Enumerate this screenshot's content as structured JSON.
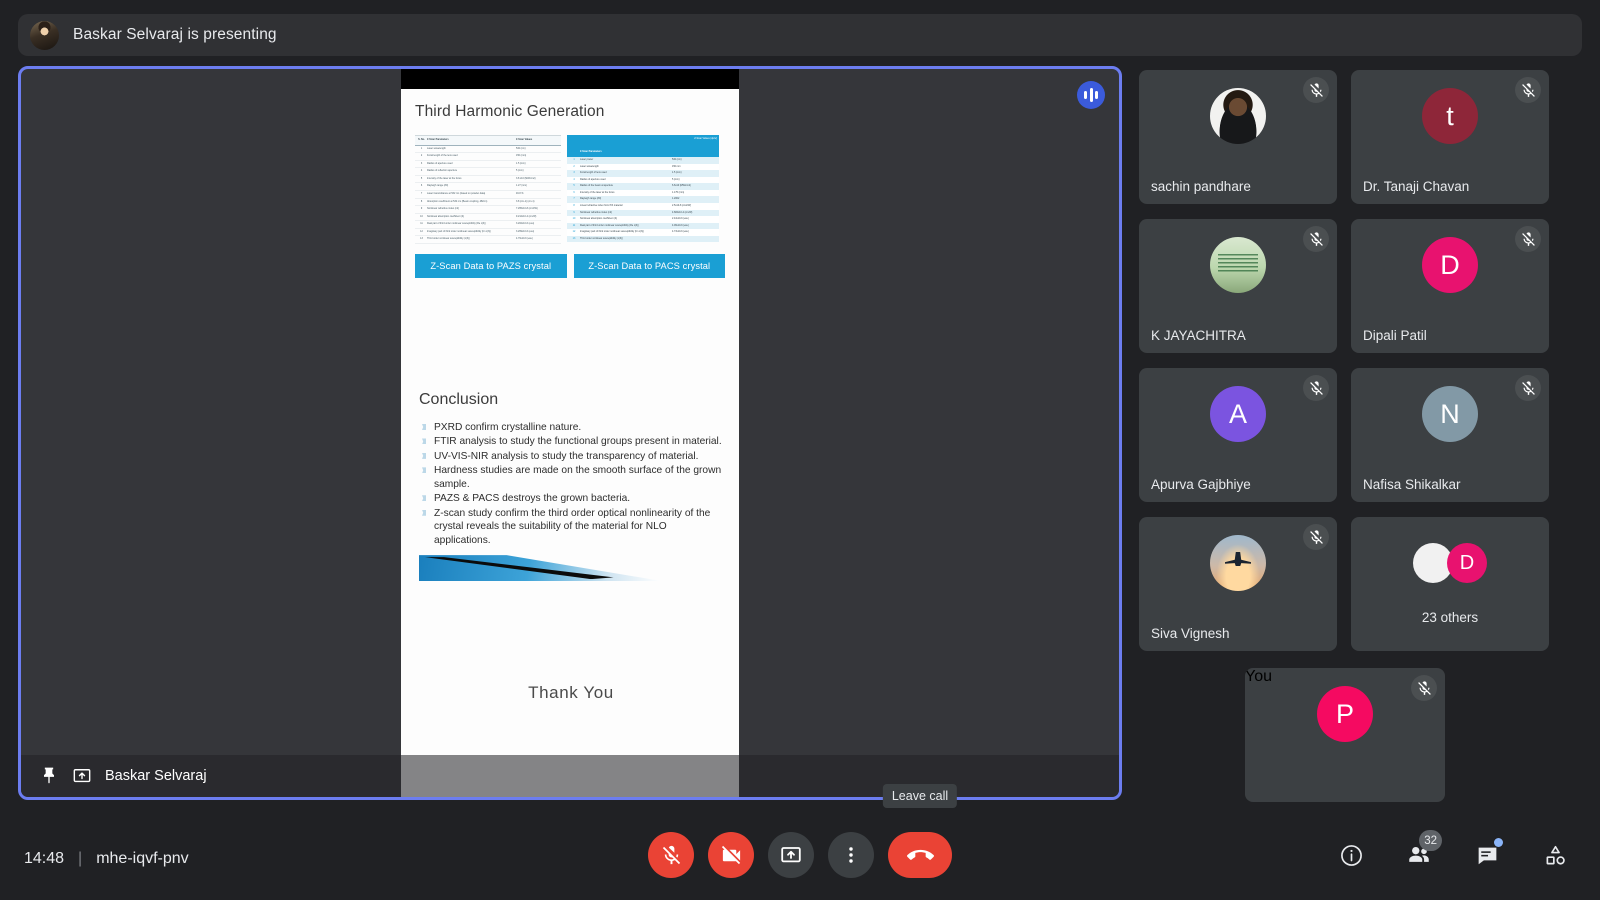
{
  "banner": {
    "text": "Baskar Selvaraj is presenting",
    "avatar_name": "presenter-avatar"
  },
  "stage": {
    "presenter_label": "Baskar Selvaraj",
    "pin_icon": "pin-icon",
    "present_icon": "present-screen-icon",
    "audio_indicator": "audio-level-icon",
    "border_color": "#6c7df0"
  },
  "slide": {
    "title": "Third Harmonic Generation",
    "table_left": {
      "headers": [
        "S. No.",
        "Z-Scan Parameters",
        "Z-Scan Values"
      ],
      "rows": [
        [
          "1",
          "Laser wavelength",
          "532 (nm)"
        ],
        [
          "2",
          "Focal length of the lens used",
          "150 (mm)"
        ],
        [
          "3",
          "Radius of aperture used",
          "1.5 (mm)"
        ],
        [
          "4",
          "Radius of reflection aperture",
          "5 (mm)"
        ],
        [
          "5",
          "Intensity of the laser at the focus",
          "3.8 x10 (MW/cm2)"
        ],
        [
          "6",
          "Rayleigh range (Z0)",
          "1.27 (mm)"
        ],
        [
          "7",
          "Laser transmittance at 532 nm (based on powder data)",
          "46.8 %"
        ],
        [
          "8",
          "Absorption coefficient at 532 nm (Beam coupling, dB/cm)",
          "3.8 (cm-1) (cm-1)"
        ],
        [
          "9",
          "Nonlinear refractive index (n2)",
          "7.265x10-8 (cm2/W)"
        ],
        [
          "10",
          "Nonlinear absorption coefficient (b)",
          "9.212x10-4 (cm/W)"
        ],
        [
          "11",
          "Real part of third order nonlinear susceptibility (Re c(3))",
          "3.202x10-6 (esu)"
        ],
        [
          "12",
          "Imaginary part of third order nonlinear susceptibility (Im c(3))",
          "3.269x10-6 (esu)"
        ],
        [
          "13",
          "Third order nonlinear susceptibility (c(3))",
          "4.79x10-6 (esu)"
        ]
      ]
    },
    "table_right": {
      "headers": [
        "S. NO.",
        "Z-Scan Parameters",
        "Z-Scan Values (dp/w)"
      ],
      "rows": [
        [
          "1",
          "Laser power",
          "532 (nm)"
        ],
        [
          "2",
          "Laser wavelength",
          "150 mm"
        ],
        [
          "3",
          "Focal length of lens used",
          "1.5 (mm)"
        ],
        [
          "4",
          "Radius of aperture used",
          "5 (mm)"
        ],
        [
          "5",
          "Radius of the beam at aperture",
          "6.6x10 (MW/cm2)"
        ],
        [
          "6",
          "Intensity of the laser at the focus",
          "1.175 (mm)"
        ],
        [
          "7",
          "Rayleigh range (Z0)",
          "1.2002"
        ],
        [
          "8",
          "Linear refractive index from Pth material",
          "2.5x10-8 (cm2/W)"
        ],
        [
          "9",
          "Nonlinear refractive index (n2)",
          "4.684x10-4 (cm/W)"
        ],
        [
          "10",
          "Nonlinear absorption coefficient (b)",
          "2.44x10-6 (esu)"
        ],
        [
          "11",
          "Real part of third order nonlinear susceptibility (Re c(3))",
          "4.09x10-6 (esu)"
        ],
        [
          "12",
          "Imaginary part of third order nonlinear susceptibility (Im c(3))",
          "4.73x10-6 (esu)"
        ],
        [
          "13",
          "Third order nonlinear susceptibility (c(3))",
          ""
        ]
      ]
    },
    "cta_left": "Z-Scan Data to PAZS crystal",
    "cta_right": "Z-Scan Data to PACS crystal",
    "conclusion_title": "Conclusion",
    "conclusion_bullets": [
      "PXRD confirm crystalline nature.",
      "FTIR analysis  to study the functional groups present in material.",
      "UV-VIS-NIR analysis to study the transparency of material.",
      "Hardness studies are made on the smooth surface of the grown sample.",
      "PAZS & PACS  destroys the grown bacteria.",
      "Z-scan study confirm the third order optical nonlinearity of the crystal reveals the suitability of the material for NLO applications."
    ],
    "thank_you": "Thank  You"
  },
  "participants": [
    {
      "name": "sachin pandhare",
      "avatar_type": "photo",
      "photo_class": "ph-sachin",
      "muted": true
    },
    {
      "name": "Dr. Tanaji Chavan",
      "avatar_type": "initial",
      "initial": "t",
      "color": "#8e2639",
      "muted": true
    },
    {
      "name": "K JAYACHITRA",
      "avatar_type": "photo",
      "photo_class": "ph-jaya",
      "muted": true
    },
    {
      "name": "Dipali Patil",
      "avatar_type": "initial",
      "initial": "D",
      "color": "#e8126f",
      "muted": true
    },
    {
      "name": "Apurva Gajbhiye",
      "avatar_type": "initial",
      "initial": "A",
      "color": "#7b54e0",
      "muted": true
    },
    {
      "name": "Nafisa Shikalkar",
      "avatar_type": "initial",
      "initial": "N",
      "color": "#8299a6",
      "muted": true
    },
    {
      "name": "Siva Vignesh",
      "avatar_type": "photo",
      "photo_class": "ph-siva",
      "muted": true
    }
  ],
  "others_tile": {
    "label": "23 others",
    "avatar_1_color": "#f1f1f1",
    "avatar_2_color": "#e8126f",
    "avatar_2_initial": "D"
  },
  "you_tile": {
    "name": "You",
    "initial": "P",
    "color": "#f50a61",
    "muted": true
  },
  "bottom": {
    "time": "14:48",
    "separator": "|",
    "meeting_code": "mhe-iqvf-pnv",
    "controls": [
      {
        "name": "mic-off-button",
        "icon": "mic-off-icon",
        "style": "red"
      },
      {
        "name": "camera-off-button",
        "icon": "camera-off-icon",
        "style": "red"
      },
      {
        "name": "present-screen-button",
        "icon": "present-screen-icon",
        "style": "grey"
      },
      {
        "name": "more-options-button",
        "icon": "more-vert-icon",
        "style": "grey"
      },
      {
        "name": "leave-call-button",
        "icon": "call-end-icon",
        "style": "leave"
      }
    ],
    "leave_tooltip": "Leave call",
    "right_actions": [
      {
        "name": "meeting-details-button",
        "icon": "info-icon"
      },
      {
        "name": "show-everyone-button",
        "icon": "people-icon",
        "badge": "32"
      },
      {
        "name": "chat-button",
        "icon": "chat-icon",
        "dot": true
      },
      {
        "name": "activities-button",
        "icon": "activities-icon"
      }
    ]
  }
}
